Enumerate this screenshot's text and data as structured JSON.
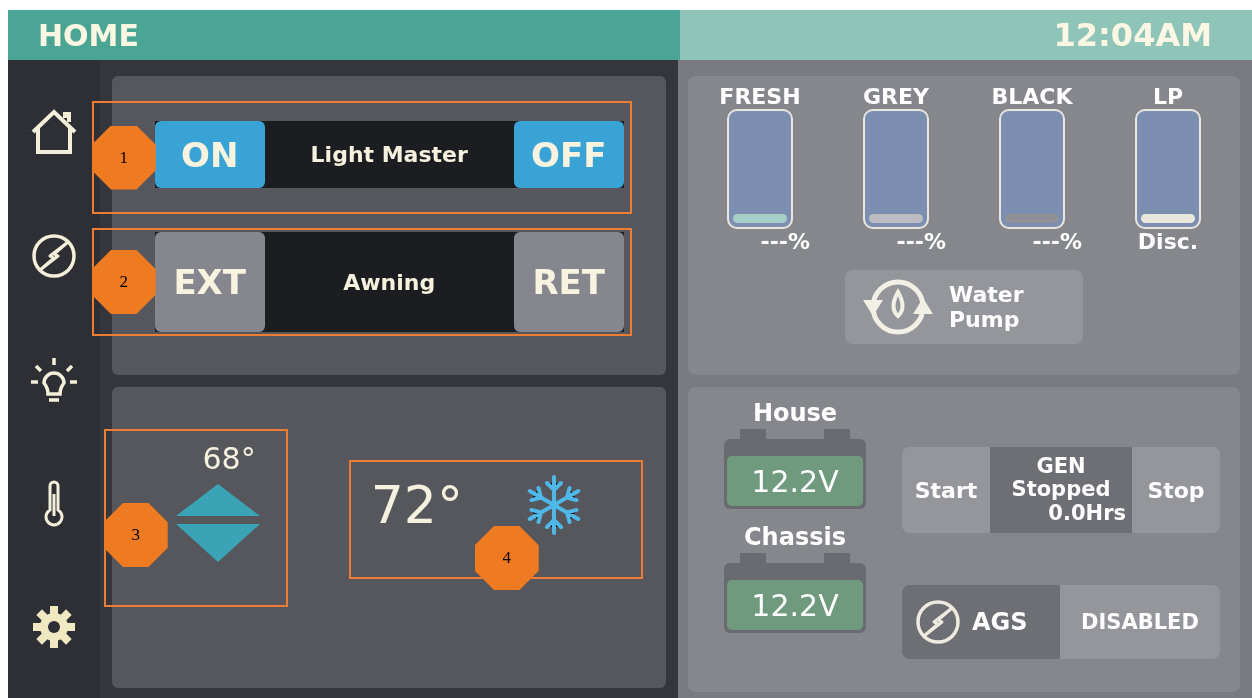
{
  "header": {
    "title": "HOME",
    "time": "12:04AM"
  },
  "controls": [
    {
      "label": "Light Master",
      "left": "ON",
      "right": "OFF",
      "highlighted": true,
      "callout": "1"
    },
    {
      "label": "Awning",
      "left": "EXT",
      "right": "RET",
      "highlighted": false,
      "callout": "2"
    }
  ],
  "setpoint": {
    "value": "68°",
    "callout": "3"
  },
  "temperature": {
    "value": "72°",
    "callout": "4"
  },
  "status_dimmed": true,
  "tanks": [
    {
      "name": "FRESH",
      "level": 0.08,
      "color": "#a6cfc8",
      "reading": "---%"
    },
    {
      "name": "GREY",
      "level": 0.08,
      "color": "#bcbdc2",
      "reading": "---%"
    },
    {
      "name": "BLACK",
      "level": 0.08,
      "color": "#909196",
      "reading": "---%"
    },
    {
      "name": "LP",
      "level": 0.08,
      "color": "#e9e6dc",
      "reading": "Disc."
    }
  ],
  "water_pump": {
    "label": "Water Pump"
  },
  "batteries": [
    {
      "name": "House",
      "reading": "12.2V"
    },
    {
      "name": "Chassis",
      "reading": "12.2V"
    }
  ],
  "generator": {
    "start": "Start",
    "title": "GEN",
    "status": "Stopped",
    "hours": "0.0Hrs",
    "stop": "Stop"
  },
  "ags": {
    "label": "AGS",
    "status": "DISABLED"
  }
}
